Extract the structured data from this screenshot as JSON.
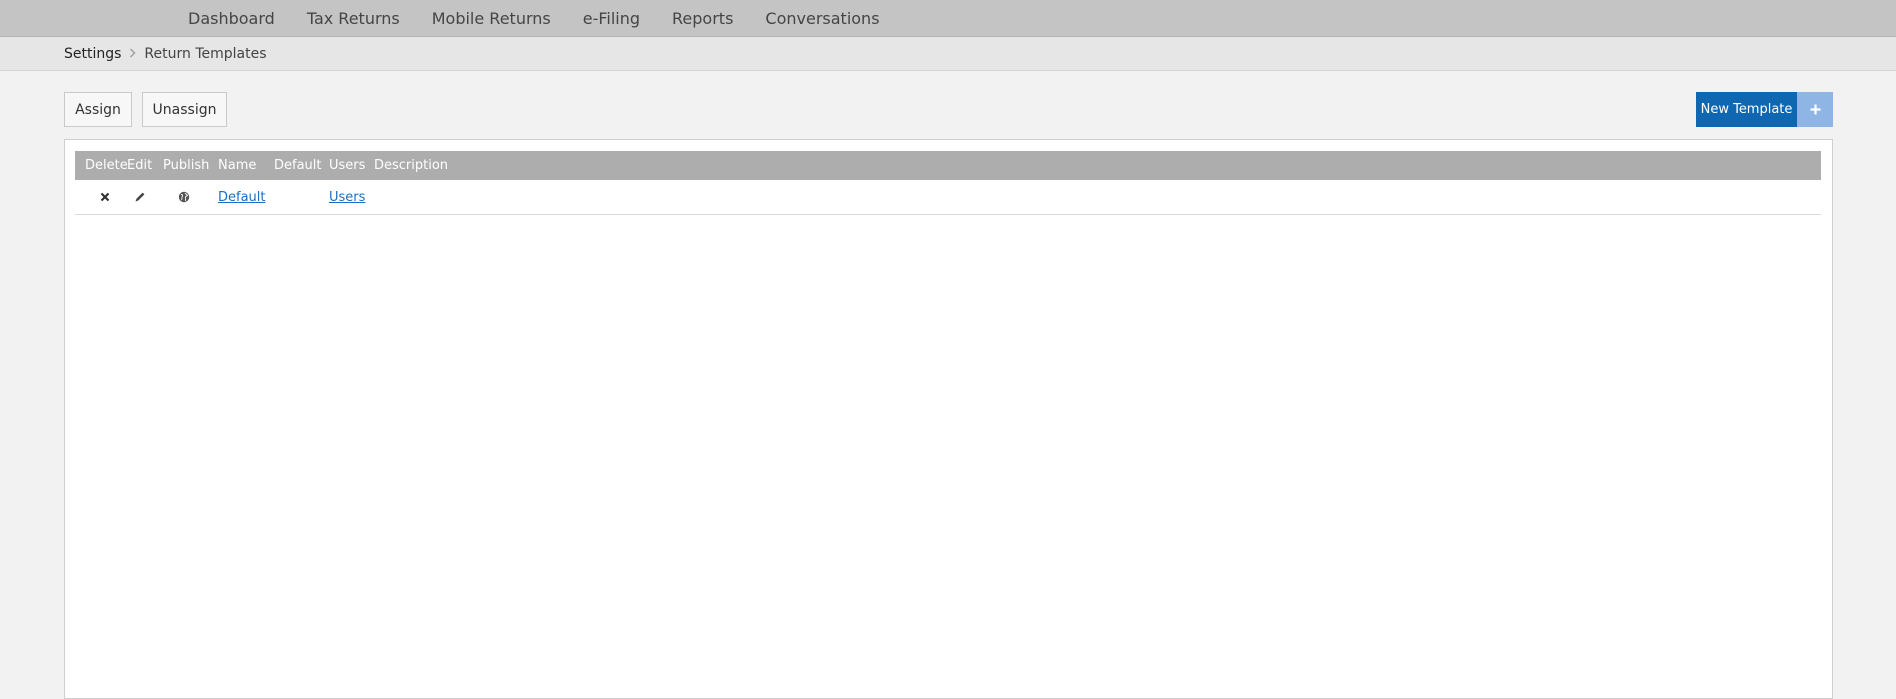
{
  "topnav": {
    "items": [
      {
        "label": "Dashboard"
      },
      {
        "label": "Tax Returns"
      },
      {
        "label": "Mobile Returns"
      },
      {
        "label": "e-Filing"
      },
      {
        "label": "Reports"
      },
      {
        "label": "Conversations"
      }
    ]
  },
  "breadcrumb": {
    "parent": "Settings",
    "separator_icon": "chevron-right-icon",
    "current": "Return Templates"
  },
  "toolbar": {
    "assign_label": "Assign",
    "unassign_label": "Unassign",
    "new_template_label": "New Template",
    "new_template_icon": "plus-icon"
  },
  "grid": {
    "columns": {
      "delete": "Delete",
      "edit": "Edit",
      "publish": "Publish",
      "name": "Name",
      "default": "Default",
      "users": "Users",
      "description": "Description"
    },
    "rows": [
      {
        "delete_icon": "close-icon",
        "edit_icon": "pencil-icon",
        "publish_icon": "globe-icon",
        "name": "Default",
        "default": "",
        "users": "Users",
        "description": ""
      }
    ]
  },
  "colors": {
    "topnav_bg": "#c4c4c4",
    "breadcrumb_bg": "#e6e6e6",
    "grid_header_bg": "#adadad",
    "primary_button": "#0f67b1",
    "primary_button_addon": "#8eb5e3",
    "link": "#1a6fc2"
  }
}
